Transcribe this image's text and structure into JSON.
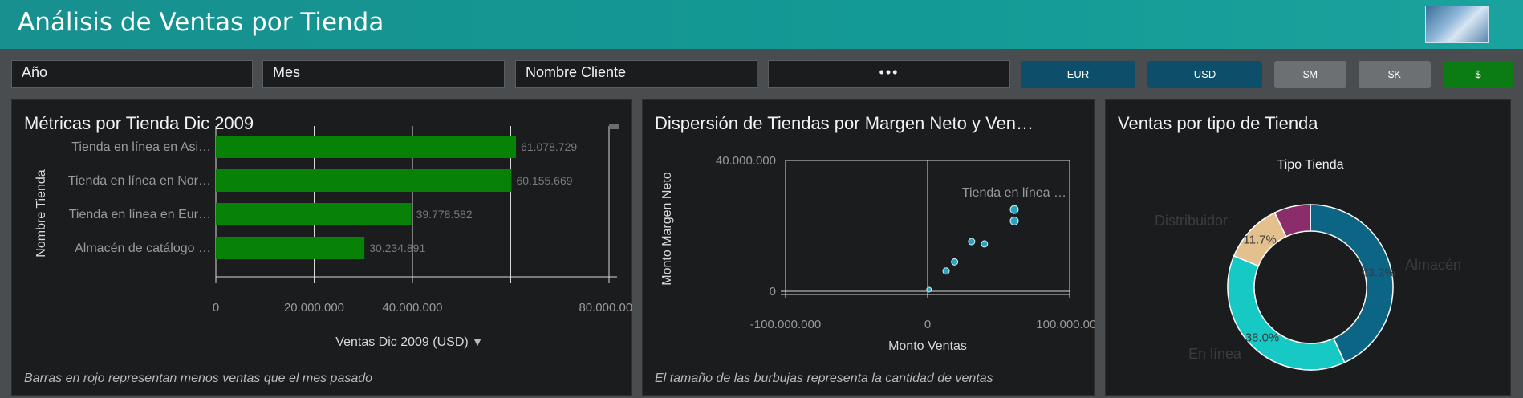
{
  "header": {
    "title": "Análisis de Ventas por Tienda"
  },
  "filters": [
    {
      "label": "Año"
    },
    {
      "label": "Mes"
    },
    {
      "label": "Nombre Cliente"
    },
    {
      "label": "•••"
    }
  ],
  "currency_buttons": {
    "eur": "EUR",
    "usd": "USD",
    "m": "$M",
    "k": "$K",
    "s": "$"
  },
  "colors": {
    "header_teal": "#17908f",
    "bar_green": "#078207",
    "button_blue": "#0d4f6a",
    "button_gray": "#6d7073",
    "button_green": "#0b7c14",
    "donut_almacen": "#0d6585",
    "donut_enlinea": "#17c9c4",
    "donut_distribuidor": "#e3c08e",
    "donut_other": "#8b2d6a"
  },
  "bar_panel": {
    "title": "Métricas por Tienda Dic 2009",
    "footnote": "Barras en rojo representan menos ventas que el mes pasado",
    "xlabel_with_sort": "▼"
  },
  "scatter_panel": {
    "title": "Dispersión de Tiendas por Margen Neto y Ven…",
    "footnote": "El tamaño de las burbujas representa la cantidad de ventas"
  },
  "donut_panel": {
    "title": "Ventas por tipo de Tienda"
  },
  "chart_data": [
    {
      "type": "bar",
      "orientation": "horizontal",
      "categories": [
        "Tienda en línea en Asi…",
        "Tienda en línea en Nor…",
        "Tienda en línea en Eur…",
        "Almacén de catálogo …"
      ],
      "values": [
        61078729,
        60155669,
        39778582,
        30234891
      ],
      "data_labels": [
        "61.078.729",
        "60.155.669",
        "39.778.582",
        "30.234.891"
      ],
      "xlabel": "Ventas Dic 2009 (USD)",
      "ylabel": "Nombre Tienda",
      "xlim": [
        0,
        80000000
      ],
      "xticks": [
        0,
        20000000,
        40000000,
        80000000
      ],
      "xtick_labels": [
        "0",
        "20.000.000",
        "40.000.000",
        "80.000.000"
      ],
      "grid": true
    },
    {
      "type": "scatter",
      "xlabel": "Monto Ventas",
      "ylabel": "Monto Margen Neto",
      "xlim": [
        -100000000,
        100000000
      ],
      "ylim": [
        0,
        40000000
      ],
      "xtick_labels": [
        "-100.000.000",
        "0",
        "100.000.000"
      ],
      "ytick_labels": [
        "0",
        "40.000.000"
      ],
      "annotation": "Tienda en línea …",
      "points": [
        {
          "x": 1000000,
          "y": 500000
        },
        {
          "x": 13000000,
          "y": 6200000
        },
        {
          "x": 19000000,
          "y": 9000000
        },
        {
          "x": 31000000,
          "y": 15200000
        },
        {
          "x": 40000000,
          "y": 14500000
        },
        {
          "x": 61000000,
          "y": 21500000
        },
        {
          "x": 61000000,
          "y": 25000000
        }
      ]
    },
    {
      "type": "pie",
      "legend_title": "Tipo Tienda",
      "slices": [
        {
          "name": "Almacén",
          "value": 43.2,
          "label": "43.2%"
        },
        {
          "name": "En línea",
          "value": 38.0,
          "label": "38.0%"
        },
        {
          "name": "Distribuidor",
          "value": 11.7,
          "label": "11.7%"
        },
        {
          "name": "",
          "value": 7.1,
          "label": ""
        }
      ]
    }
  ]
}
